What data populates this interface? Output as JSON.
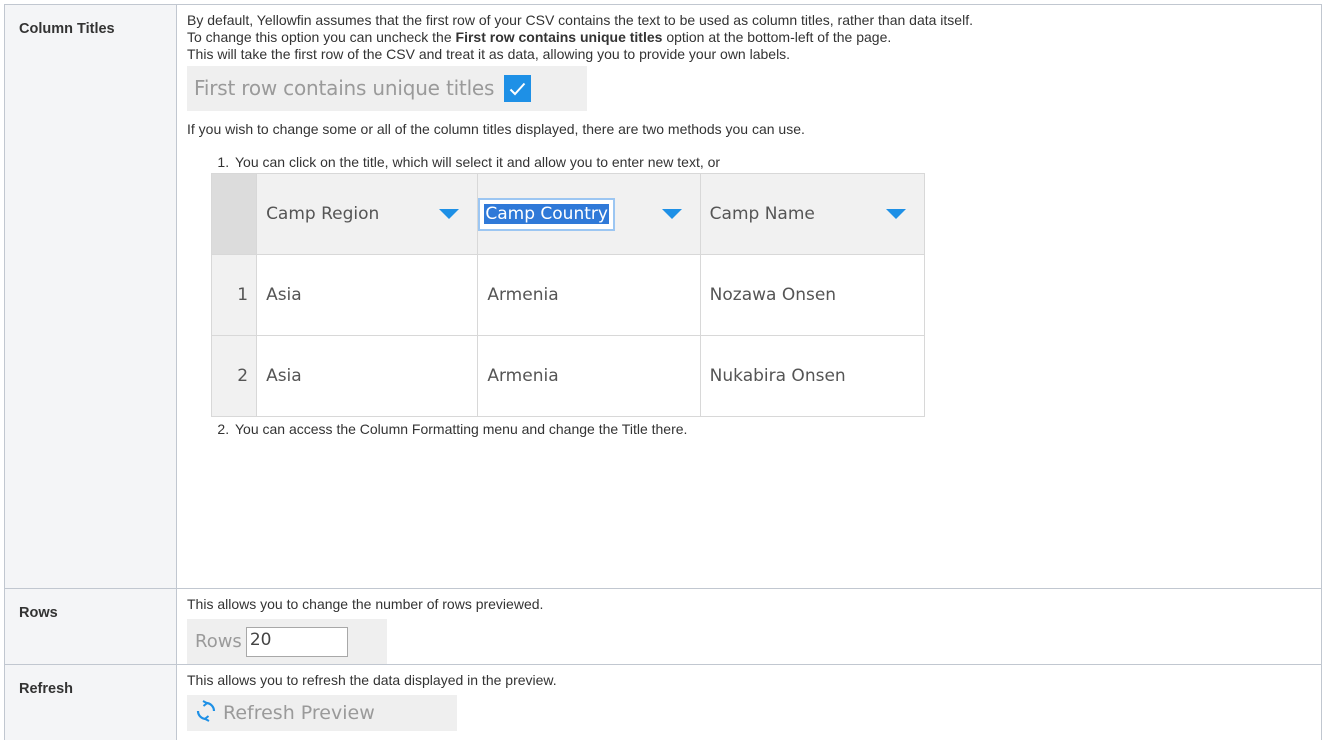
{
  "rows": [
    {
      "heading": "Column Titles",
      "line1": "By default, Yellowfin assumes that the first row of your CSV contains the text to be used as column titles, rather than data itself.",
      "line2_prefix": "To change this option you can uncheck the ",
      "line2_bold": "First row contains unique titles",
      "line2_suffix": " option at the bottom-left of the page.",
      "line3": "This will take the first row of the CSV and treat it as data, allowing you to provide your own labels.",
      "widget_label": "First row contains unique titles",
      "widget_checked": true,
      "line4": "If you wish to change some or all of the column titles displayed, there are two methods you can use.",
      "method1": "You can click on the title, which will select it and allow you to enter new text, or",
      "method2": "You can access the Column Formatting menu and change the Title there.",
      "grid": {
        "headers": [
          "Camp Region",
          "Camp Country",
          "Camp Name"
        ],
        "editing_header": "Camp Country",
        "rows": [
          {
            "index": "1",
            "cells": [
              "Asia",
              "Armenia",
              "Nozawa Onsen"
            ]
          },
          {
            "index": "2",
            "cells": [
              "Asia",
              "Armenia",
              "Nukabira Onsen"
            ]
          }
        ]
      }
    },
    {
      "heading": "Rows",
      "line1": "This allows you to change the number of rows previewed.",
      "widget_label": "Rows",
      "widget_value": "20"
    },
    {
      "heading": "Refresh",
      "line1": "This allows you to refresh the data displayed in the preview.",
      "widget_label": "Refresh Preview",
      "icon": "refresh-icon"
    }
  ],
  "colors": {
    "accent": "#1e90e6",
    "header_bg": "#f4f5f7",
    "border": "#c1c7d0"
  }
}
